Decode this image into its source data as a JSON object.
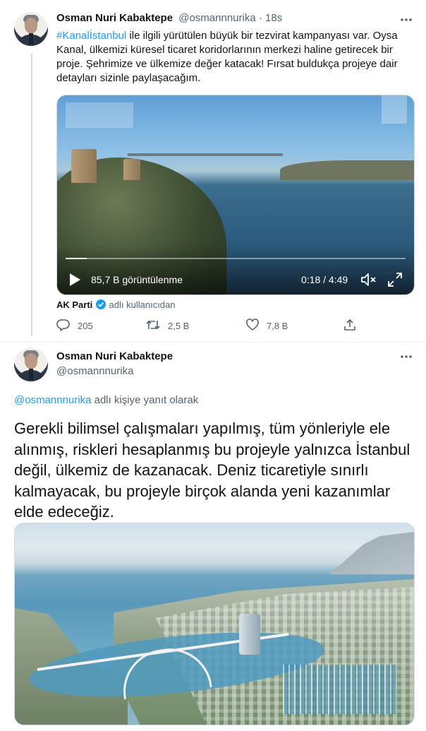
{
  "tweet1": {
    "author_name": "Osman Nuri Kabaktepe",
    "handle": "@osmannnurika",
    "separator": "·",
    "time": "18s",
    "hashtag": "#Kanalİstanbul",
    "text": " ile ilgili yürütülen büyük bir tezvirat kampanyası var. Oysa Kanal, ülkemizi küresel ticaret koridorlarının merkezi haline getirecek bir proje. Şehrimize ve ülkemize değer katacak! Fırsat buldukça projeye dair detayları sizinle paylaşacağım.",
    "video": {
      "views": "85,7 B görüntülenme",
      "time": "0:18 / 4:49",
      "progress_fraction": 0.062
    },
    "attribution": {
      "account": "AK Parti",
      "suffix": "adlı kullanıcıdan"
    },
    "actions": {
      "replies": "205",
      "retweets": "2,5 B",
      "likes": "7,8 B"
    }
  },
  "tweet2": {
    "author_name": "Osman Nuri Kabaktepe",
    "handle": "@osmannnurika",
    "reply_to_handle": "@osmannnurika",
    "reply_to_suffix": " adlı kişiye yanıt olarak",
    "text": "Gerekli bilimsel çalışmaları yapılmış, tüm yönleriyle ele alınmış, riskleri hesaplanmış bu projeyle yalnızca İstanbul değil, ülkemiz de kazanacak. Deniz ticaretiyle sınırlı kalmayacak, bu projeyle birçok alanda yeni kazanımlar elde edeceğiz."
  },
  "icons": [
    "more-icon",
    "play-icon",
    "mute-icon",
    "fullscreen-icon",
    "verified-icon",
    "reply-icon",
    "retweet-icon",
    "like-icon",
    "share-icon"
  ],
  "colors": {
    "link": "#1d9bf0",
    "muted": "#536471",
    "text": "#0f1419"
  }
}
